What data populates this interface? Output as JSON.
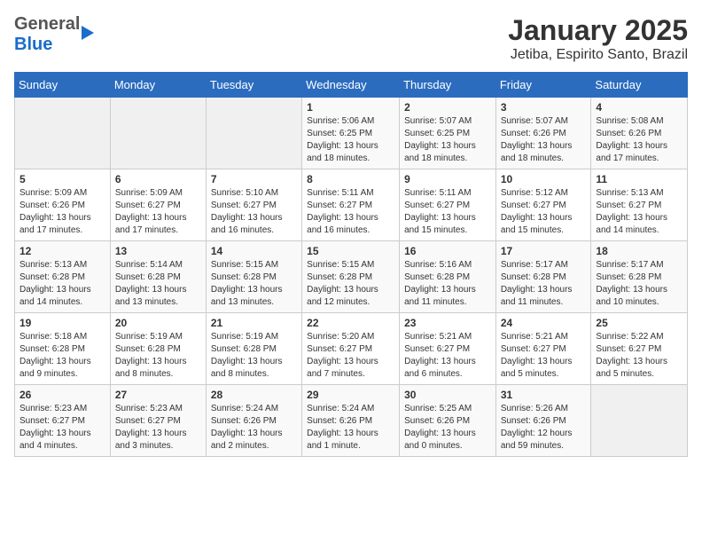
{
  "header": {
    "logo_general": "General",
    "logo_blue": "Blue",
    "month": "January 2025",
    "location": "Jetiba, Espirito Santo, Brazil"
  },
  "weekdays": [
    "Sunday",
    "Monday",
    "Tuesday",
    "Wednesday",
    "Thursday",
    "Friday",
    "Saturday"
  ],
  "weeks": [
    [
      {
        "day": "",
        "info": ""
      },
      {
        "day": "",
        "info": ""
      },
      {
        "day": "",
        "info": ""
      },
      {
        "day": "1",
        "info": "Sunrise: 5:06 AM\nSunset: 6:25 PM\nDaylight: 13 hours\nand 18 minutes."
      },
      {
        "day": "2",
        "info": "Sunrise: 5:07 AM\nSunset: 6:25 PM\nDaylight: 13 hours\nand 18 minutes."
      },
      {
        "day": "3",
        "info": "Sunrise: 5:07 AM\nSunset: 6:26 PM\nDaylight: 13 hours\nand 18 minutes."
      },
      {
        "day": "4",
        "info": "Sunrise: 5:08 AM\nSunset: 6:26 PM\nDaylight: 13 hours\nand 17 minutes."
      }
    ],
    [
      {
        "day": "5",
        "info": "Sunrise: 5:09 AM\nSunset: 6:26 PM\nDaylight: 13 hours\nand 17 minutes."
      },
      {
        "day": "6",
        "info": "Sunrise: 5:09 AM\nSunset: 6:27 PM\nDaylight: 13 hours\nand 17 minutes."
      },
      {
        "day": "7",
        "info": "Sunrise: 5:10 AM\nSunset: 6:27 PM\nDaylight: 13 hours\nand 16 minutes."
      },
      {
        "day": "8",
        "info": "Sunrise: 5:11 AM\nSunset: 6:27 PM\nDaylight: 13 hours\nand 16 minutes."
      },
      {
        "day": "9",
        "info": "Sunrise: 5:11 AM\nSunset: 6:27 PM\nDaylight: 13 hours\nand 15 minutes."
      },
      {
        "day": "10",
        "info": "Sunrise: 5:12 AM\nSunset: 6:27 PM\nDaylight: 13 hours\nand 15 minutes."
      },
      {
        "day": "11",
        "info": "Sunrise: 5:13 AM\nSunset: 6:27 PM\nDaylight: 13 hours\nand 14 minutes."
      }
    ],
    [
      {
        "day": "12",
        "info": "Sunrise: 5:13 AM\nSunset: 6:28 PM\nDaylight: 13 hours\nand 14 minutes."
      },
      {
        "day": "13",
        "info": "Sunrise: 5:14 AM\nSunset: 6:28 PM\nDaylight: 13 hours\nand 13 minutes."
      },
      {
        "day": "14",
        "info": "Sunrise: 5:15 AM\nSunset: 6:28 PM\nDaylight: 13 hours\nand 13 minutes."
      },
      {
        "day": "15",
        "info": "Sunrise: 5:15 AM\nSunset: 6:28 PM\nDaylight: 13 hours\nand 12 minutes."
      },
      {
        "day": "16",
        "info": "Sunrise: 5:16 AM\nSunset: 6:28 PM\nDaylight: 13 hours\nand 11 minutes."
      },
      {
        "day": "17",
        "info": "Sunrise: 5:17 AM\nSunset: 6:28 PM\nDaylight: 13 hours\nand 11 minutes."
      },
      {
        "day": "18",
        "info": "Sunrise: 5:17 AM\nSunset: 6:28 PM\nDaylight: 13 hours\nand 10 minutes."
      }
    ],
    [
      {
        "day": "19",
        "info": "Sunrise: 5:18 AM\nSunset: 6:28 PM\nDaylight: 13 hours\nand 9 minutes."
      },
      {
        "day": "20",
        "info": "Sunrise: 5:19 AM\nSunset: 6:28 PM\nDaylight: 13 hours\nand 8 minutes."
      },
      {
        "day": "21",
        "info": "Sunrise: 5:19 AM\nSunset: 6:28 PM\nDaylight: 13 hours\nand 8 minutes."
      },
      {
        "day": "22",
        "info": "Sunrise: 5:20 AM\nSunset: 6:27 PM\nDaylight: 13 hours\nand 7 minutes."
      },
      {
        "day": "23",
        "info": "Sunrise: 5:21 AM\nSunset: 6:27 PM\nDaylight: 13 hours\nand 6 minutes."
      },
      {
        "day": "24",
        "info": "Sunrise: 5:21 AM\nSunset: 6:27 PM\nDaylight: 13 hours\nand 5 minutes."
      },
      {
        "day": "25",
        "info": "Sunrise: 5:22 AM\nSunset: 6:27 PM\nDaylight: 13 hours\nand 5 minutes."
      }
    ],
    [
      {
        "day": "26",
        "info": "Sunrise: 5:23 AM\nSunset: 6:27 PM\nDaylight: 13 hours\nand 4 minutes."
      },
      {
        "day": "27",
        "info": "Sunrise: 5:23 AM\nSunset: 6:27 PM\nDaylight: 13 hours\nand 3 minutes."
      },
      {
        "day": "28",
        "info": "Sunrise: 5:24 AM\nSunset: 6:26 PM\nDaylight: 13 hours\nand 2 minutes."
      },
      {
        "day": "29",
        "info": "Sunrise: 5:24 AM\nSunset: 6:26 PM\nDaylight: 13 hours\nand 1 minute."
      },
      {
        "day": "30",
        "info": "Sunrise: 5:25 AM\nSunset: 6:26 PM\nDaylight: 13 hours\nand 0 minutes."
      },
      {
        "day": "31",
        "info": "Sunrise: 5:26 AM\nSunset: 6:26 PM\nDaylight: 12 hours\nand 59 minutes."
      },
      {
        "day": "",
        "info": ""
      }
    ]
  ]
}
